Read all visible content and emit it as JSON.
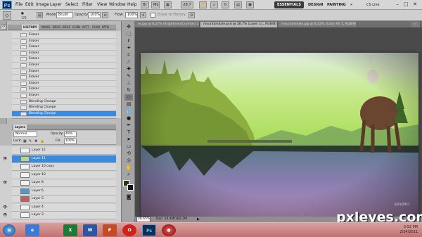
{
  "menubar": {
    "logo": "Ps",
    "items": [
      "File",
      "Edit",
      "Image",
      "Layer",
      "Select",
      "Filter",
      "View",
      "Window",
      "Help"
    ],
    "zoom": "28.7",
    "workspaces": [
      "ESSENTIALS",
      "DESIGN",
      "PAINTING"
    ],
    "cs_live": "CS Live",
    "more": "»"
  },
  "options": {
    "brush_size": "175",
    "mode_label": "Mode:",
    "mode_value": "Brush",
    "opacity_label": "Opacity:",
    "opacity_value": "100%",
    "flow_label": "Flow:",
    "flow_value": "100%",
    "erase_to_history": "Erase to History"
  },
  "history_panel": {
    "tabs": [
      "HISTORY",
      "NAVIG",
      "BRUS",
      "BRUS",
      "CLON",
      "ACTI",
      "CHAR",
      "PATH"
    ],
    "items": [
      "Eraser",
      "Eraser",
      "Eraser",
      "Eraser",
      "Eraser",
      "Eraser",
      "Eraser",
      "Eraser",
      "Eraser",
      "Eraser",
      "Eraser",
      "Blending Change",
      "Blending Change",
      "Blending Change"
    ],
    "selected_index": 13
  },
  "layers_panel": {
    "tab": "Layers",
    "blend_mode": "Normal",
    "opacity_label": "Opacity:",
    "opacity_value": "49%",
    "lock_label": "Lock:",
    "fill_label": "Fill:",
    "fill_value": "100%",
    "layers": [
      {
        "name": "Layer 12",
        "visible": false,
        "thumb": "#f2f2f2"
      },
      {
        "name": "Layer 11",
        "visible": true,
        "thumb": "#b6d88a"
      },
      {
        "name": "Layer 10 copy",
        "visible": false,
        "thumb": "#f2f2f2"
      },
      {
        "name": "Layer 10",
        "visible": false,
        "thumb": "#f2f2f2"
      },
      {
        "name": "Layer 8",
        "visible": true,
        "thumb": "#f2f2f2"
      },
      {
        "name": "Layer 6",
        "visible": false,
        "thumb": "#4d9ad0"
      },
      {
        "name": "Layer 5",
        "visible": false,
        "thumb": "#c65c5c"
      },
      {
        "name": "Layer 4",
        "visible": true,
        "thumb": "#f2f2f2"
      },
      {
        "name": "Layer 3",
        "visible": true,
        "thumb": "#f2f2f2"
      }
    ],
    "selected_index": 1
  },
  "documents": {
    "tabs": [
      "m.jpg @ 8.22% (Brightness/Contrast 2, RGB/8) *",
      "mountaindale.psd @ 28.7% (Layer 11, RGB/8) *",
      "mountaindale.jpg @ 8.22% (Color Fill 1, RGB/8) *",
      "»"
    ],
    "active_index": 1,
    "status_zoom": "28.65%",
    "status_doc": "Doc: 14.4M/182.2M"
  },
  "taskbar": {
    "apps": [
      "start",
      "ie",
      "excel",
      "word",
      "powerpoint",
      "opera",
      "photoshop",
      "record"
    ],
    "clock_time": "3:52 PM",
    "clock_date": "2/24/2011"
  },
  "watermark": {
    "brand": "pxleyes.com",
    "date": "3/24/2011"
  },
  "colors": {
    "selection_blue": "#3a8be0",
    "panel_gray": "#b9b9b9",
    "taskbar_red": "#c07272",
    "ps_blue": "#0b2f56"
  }
}
